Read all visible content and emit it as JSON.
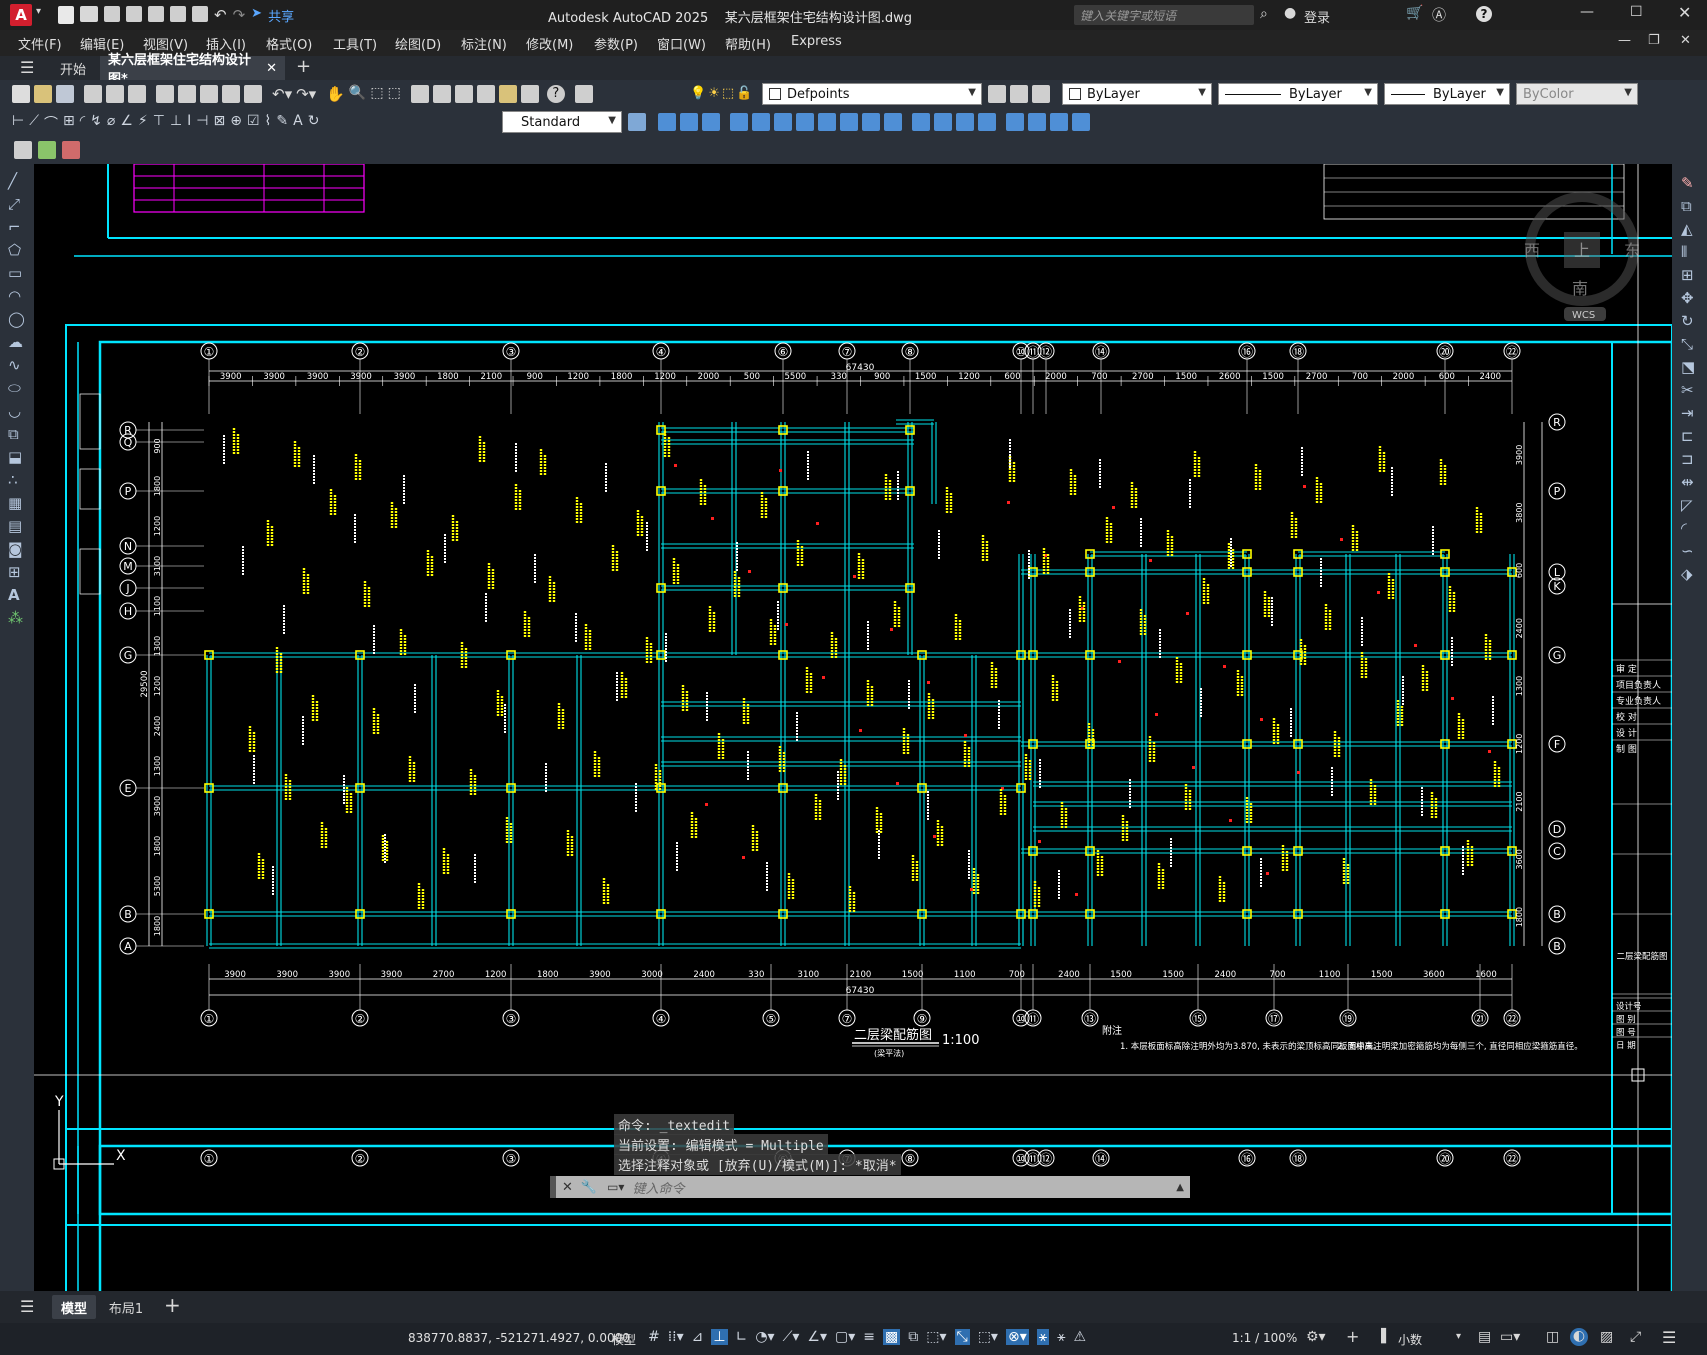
{
  "app": {
    "title": "Autodesk AutoCAD 2025    某六层框架住宅结构设计图.dwg",
    "logo": "A",
    "share_label": "共享",
    "search_placeholder": "键入关键字或短语",
    "login_label": "登录",
    "help_label": "?"
  },
  "menu": [
    "文件(F)",
    "编辑(E)",
    "视图(V)",
    "插入(I)",
    "格式(O)",
    "工具(T)",
    "绘图(D)",
    "标注(N)",
    "修改(M)",
    "参数(P)",
    "窗口(W)",
    "帮助(H)",
    "Express"
  ],
  "tabs": {
    "start": "开始",
    "doc": "某六层框架住宅结构设计图*"
  },
  "toolbar": {
    "layer_value": "Defpoints",
    "color_value": "ByLayer",
    "linetype_value": "ByLayer",
    "lineweight_value": "ByLayer",
    "plotstyle_value": "ByColor",
    "textstyle_value": "Standard"
  },
  "viewcube": {
    "west": "西",
    "south": "南",
    "east": "东",
    "top": "上",
    "wcs": "WCS"
  },
  "drawing": {
    "top_axes": [
      "①",
      "②",
      "③",
      "④",
      "⑥",
      "⑦",
      "⑧",
      "⑩",
      "⑪",
      "⑫",
      "⑭",
      "⑯",
      "⑱",
      "⑳",
      "㉒"
    ],
    "bottom_axes": [
      "①",
      "②",
      "③",
      "④",
      "⑤",
      "⑦",
      "⑨",
      "⑩",
      "⑪",
      "⑬",
      "⑮",
      "⑰",
      "⑲",
      "㉑",
      "㉒"
    ],
    "left_axes": [
      "R",
      "Q",
      "P",
      "N",
      "M",
      "J",
      "H",
      "G",
      "E",
      "B",
      "A"
    ],
    "right_axes": [
      "R",
      "P",
      "L",
      "K",
      "G",
      "F",
      "D",
      "C",
      "B",
      "B"
    ],
    "top_dims": [
      "3900",
      "3900",
      "3900",
      "3900",
      "3900",
      "1800",
      "2100",
      "900",
      "1200",
      "1800",
      "1200",
      "2000",
      "500",
      "5500",
      "330",
      "900",
      "1500",
      "1200",
      "600",
      "2000",
      "700",
      "2700",
      "1500",
      "2600",
      "1500",
      "2700",
      "700",
      "2000",
      "600",
      "2400"
    ],
    "total_dim": "67430",
    "bottom_dims": [
      "3900",
      "3900",
      "3900",
      "3900",
      "2700",
      "1200",
      "1800",
      "3900",
      "3000",
      "2400",
      "330",
      "3100",
      "2100",
      "1500",
      "1100",
      "700",
      "2400",
      "1500",
      "1500",
      "2400",
      "700",
      "1100",
      "1500",
      "3600",
      "1600"
    ],
    "plan_title": "二层梁配筋图",
    "plan_scale": "1:100",
    "plan_subtitle": "(梁平法)",
    "note_head": "附注",
    "note1": "1. 本层板面标高除注明外均为3.870, 未表示的梁顶标高同板面标高。",
    "note2": "2. 图中未注明梁加密箍筋均为每侧三个, 直径同相应梁箍筋直径。",
    "left_dims": [
      "900",
      "1800",
      "1200",
      "3100",
      "1100",
      "1300",
      "1200",
      "2400",
      "1300",
      "3900",
      "1800",
      "5300",
      "1800"
    ],
    "left_total": "29500",
    "right_dims": [
      "3900",
      "3800",
      "600",
      "2400",
      "1300",
      "1200",
      "2100",
      "3600",
      "1800"
    ],
    "title_block": [
      "审 定",
      "项目负责人",
      "专业负责人",
      "校 对",
      "设 计",
      "制 图",
      "二层梁配筋图",
      "设计号",
      "图 别",
      "图 号",
      "日 期"
    ]
  },
  "command": {
    "line1": "命令: _textedit",
    "line2": "当前设置: 编辑模式 = Multiple",
    "line3": "选择注释对象或 [放弃(U)/模式(M)]: *取消*",
    "placeholder": "键入命令"
  },
  "layout_tabs": [
    "模型",
    "布局1"
  ],
  "status": {
    "coords": "838770.8837, -521271.4927, 0.0000",
    "model": "模型",
    "scale": "1:1 / 100%",
    "units": "小数"
  },
  "colors": {
    "accent": "#00e5ff",
    "beam": "#00e0e8",
    "label": "#ffff00",
    "dim": "#ffffff",
    "column": "#ffff00",
    "red": "#ff2020",
    "magenta": "#ff00ff"
  }
}
